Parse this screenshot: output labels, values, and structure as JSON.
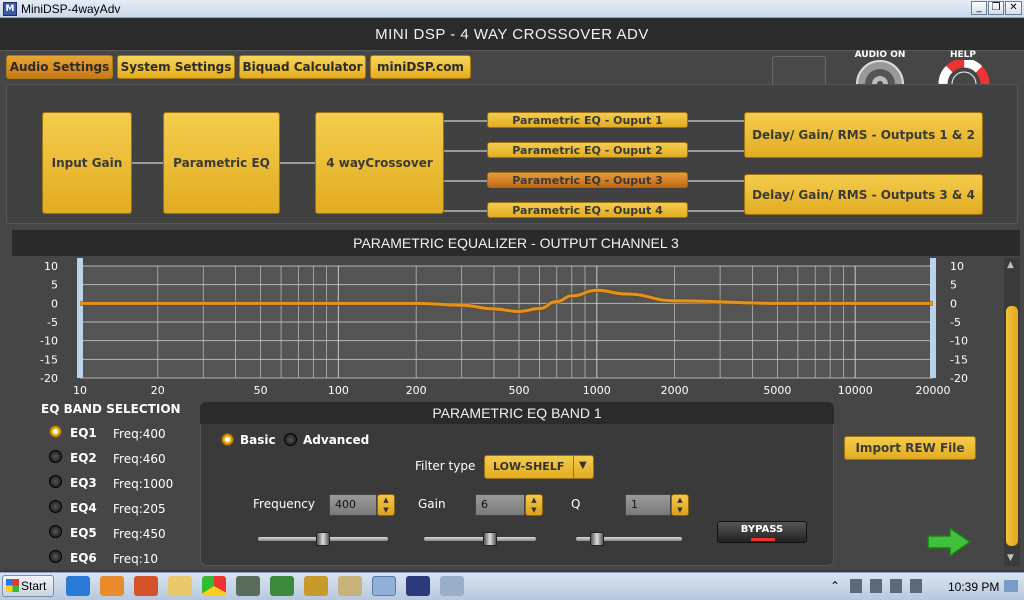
{
  "window": {
    "title": "MiniDSP-4wayAdv",
    "app_icon_label": "M"
  },
  "app": {
    "title": "MINI DSP - 4 WAY CROSSOVER ADV"
  },
  "tabs": [
    {
      "label": "Audio Settings",
      "active": true
    },
    {
      "label": "System Settings"
    },
    {
      "label": "Biquad Calculator"
    },
    {
      "label": "miniDSP.com"
    }
  ],
  "header_controls": {
    "audio_on_label": "AUDIO ON",
    "help_label": "HELP"
  },
  "signal_chain": {
    "input_gain": "Input Gain",
    "parametric_eq": "Parametric EQ",
    "crossover": "4 wayCrossover",
    "outputs": [
      "Parametric EQ - Ouput 1",
      "Parametric EQ - Ouput 2",
      "Parametric EQ - Ouput 3",
      "Parametric EQ - Ouput 4"
    ],
    "active_output_index": 2,
    "delay_12": "Delay/ Gain/ RMS - Outputs 1 & 2",
    "delay_34": "Delay/ Gain/ RMS - Outputs 3 & 4"
  },
  "graph": {
    "title": "PARAMETRIC EQUALIZER - OUTPUT CHANNEL 3",
    "y_ticks": [
      "10",
      "5",
      "0",
      "-5",
      "-10",
      "-15",
      "-20"
    ],
    "x_ticks": [
      "10",
      "20",
      "50",
      "100",
      "200",
      "500",
      "1000",
      "2000",
      "5000",
      "10000",
      "20000"
    ]
  },
  "chart_data": {
    "type": "line",
    "ylim": [
      -20,
      10
    ],
    "x_scale": "log",
    "xlim": [
      10,
      20000
    ],
    "grid": true,
    "series": [
      {
        "x": [
          10,
          200,
          300,
          400,
          500,
          600,
          700,
          800,
          1000,
          1300,
          2000,
          5000,
          20000
        ],
        "values": [
          0,
          0,
          -0.5,
          -1.5,
          -2.2,
          -1.4,
          0.5,
          2.0,
          3.5,
          2.5,
          0.7,
          0,
          0
        ],
        "color": "#e8901e"
      }
    ]
  },
  "eq_band_selection": {
    "title": "EQ BAND SELECTION",
    "bands": [
      {
        "name": "EQ1",
        "freq": "Freq:400",
        "selected": true
      },
      {
        "name": "EQ2",
        "freq": "Freq:460"
      },
      {
        "name": "EQ3",
        "freq": "Freq:1000"
      },
      {
        "name": "EQ4",
        "freq": "Freq:205"
      },
      {
        "name": "EQ5",
        "freq": "Freq:450"
      },
      {
        "name": "EQ6",
        "freq": "Freq:10"
      }
    ]
  },
  "band_panel": {
    "title": "PARAMETRIC EQ BAND 1",
    "mode_basic": "Basic",
    "mode_advanced": "Advanced",
    "filter_type_label": "Filter type",
    "filter_type_value": "LOW-SHELF",
    "frequency_label": "Frequency",
    "frequency_value": "400",
    "gain_label": "Gain",
    "gain_value": "6",
    "q_label": "Q",
    "q_value": "1",
    "bypass_label": "BYPASS",
    "freq_slider": 0.5,
    "gain_slider": 0.6,
    "q_slider": 0.15
  },
  "import_rew": "Import REW File",
  "taskbar": {
    "start": "Start",
    "clock": "10:39 PM"
  },
  "colors": {
    "accent": "#f2c23b",
    "active_orange": "#d9801f",
    "curve": "#e8901e"
  }
}
